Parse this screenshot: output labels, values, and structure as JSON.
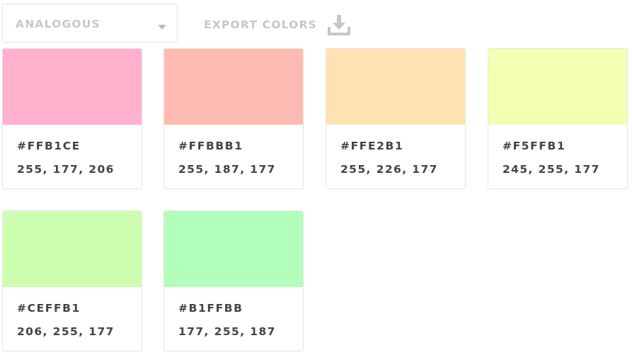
{
  "toolbar": {
    "scheme_select": {
      "selected": "ANALOGOUS",
      "icon": "chevron-down-icon"
    },
    "export": {
      "label": "EXPORT COLORS",
      "icon": "download-icon"
    }
  },
  "colors": [
    {
      "hex": "#FFB1CE",
      "rgb": "255, 177, 206",
      "swatch": "#FFB1CE"
    },
    {
      "hex": "#FFBBB1",
      "rgb": "255, 187, 177",
      "swatch": "#FFBBB1"
    },
    {
      "hex": "#FFE2B1",
      "rgb": "255, 226, 177",
      "swatch": "#FFE2B1"
    },
    {
      "hex": "#F5FFB1",
      "rgb": "245, 255, 177",
      "swatch": "#F5FFB1"
    },
    {
      "hex": "#CEFFB1",
      "rgb": "206, 255, 177",
      "swatch": "#CEFFB1"
    },
    {
      "hex": "#B1FFBB",
      "rgb": "177, 255, 187",
      "swatch": "#B1FFBB"
    }
  ],
  "theme": {
    "text_color": "#444444",
    "muted_text_color": "#C8C8C8",
    "border_color": "#E4E4E4"
  }
}
